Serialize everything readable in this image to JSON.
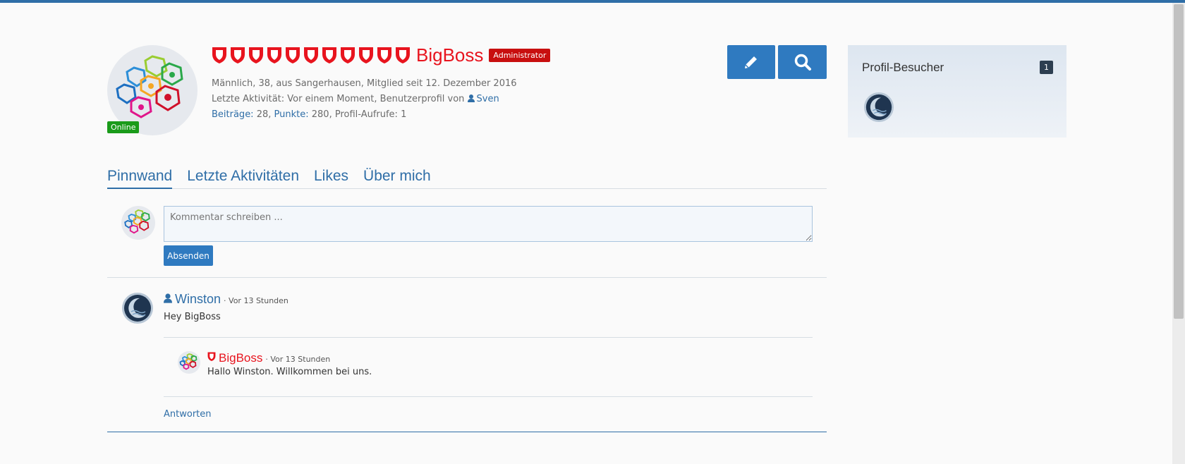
{
  "profile": {
    "username": "BigBoss",
    "rank_badge": "Administrator",
    "status": "Online",
    "rank_icon_count": 11,
    "meta_line1": "Männlich,  38,  aus Sangerhausen,  Mitglied seit 12. Dezember 2016",
    "meta_line2_prefix": "Letzte Aktivität: Vor einem Moment,  Benutzerprofil von",
    "meta_line2_user": "Sven",
    "stats": {
      "posts_label": "Beiträge:",
      "posts_value": "28",
      "points_label": "Punkte:",
      "points_value": "280",
      "views_text": "Profil-Aufrufe: 1"
    }
  },
  "actions": {
    "edit_icon": "pencil-icon",
    "search_icon": "search-icon"
  },
  "tabs": [
    {
      "label": "Pinnwand",
      "active": true
    },
    {
      "label": "Letzte Aktivitäten",
      "active": false
    },
    {
      "label": "Likes",
      "active": false
    },
    {
      "label": "Über mich",
      "active": false
    }
  ],
  "comment_form": {
    "placeholder": "Kommentar schreiben ...",
    "submit_label": "Absenden"
  },
  "wall": {
    "post": {
      "author": "Winston",
      "time": "· Vor 13 Stunden",
      "text": "Hey BigBoss"
    },
    "reply": {
      "author": "BigBoss",
      "time": "· Vor 13 Stunden",
      "text": "Hallo Winston. Willkommen bei uns."
    },
    "reply_link": "Antworten"
  },
  "sidebar": {
    "title": "Profil-Besucher",
    "count": "1"
  },
  "colors": {
    "accent": "#2f7ac0",
    "admin_red": "#e8141e",
    "online_green": "#1a9b1a"
  }
}
